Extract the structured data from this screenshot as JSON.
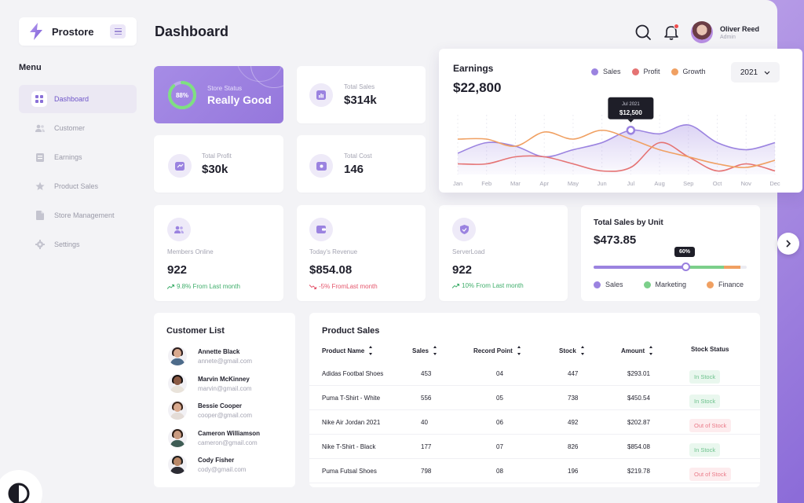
{
  "app": {
    "name": "Prostore"
  },
  "sidebar": {
    "heading": "Menu",
    "items": [
      {
        "label": "Dashboard",
        "icon": "grid-icon",
        "active": true
      },
      {
        "label": "Customer",
        "icon": "users-icon",
        "active": false
      },
      {
        "label": "Earnings",
        "icon": "ledger-icon",
        "active": false
      },
      {
        "label": "Product Sales",
        "icon": "star-icon",
        "active": false
      },
      {
        "label": "Store Management",
        "icon": "document-icon",
        "active": false
      },
      {
        "label": "Settings",
        "icon": "gear-icon",
        "active": false
      }
    ]
  },
  "header": {
    "title": "Dashboard",
    "user": {
      "name": "Oliver Reed",
      "role": "Admin"
    }
  },
  "store_status": {
    "label": "Store Status",
    "value": "Really Good",
    "percent_text": "88%",
    "percent": 0.88
  },
  "stats": {
    "total_sales": {
      "label": "Total Sales",
      "value": "$314k"
    },
    "total_profit": {
      "label": "Total Profit",
      "value": "$30k"
    },
    "total_cost": {
      "label": "Total Cost",
      "value": "146"
    }
  },
  "metrics": {
    "members_online": {
      "label": "Members Online",
      "value": "922",
      "trend": "9.8% From Last month",
      "direction": "up"
    },
    "todays_revenue": {
      "label": "Today's Revenue",
      "value": "$854.08",
      "trend": "-5% FromLast month",
      "direction": "down"
    },
    "server_load": {
      "label": "ServerLoad",
      "value": "922",
      "trend": "10% From Last month",
      "direction": "up"
    }
  },
  "earnings": {
    "title": "Earnings",
    "total": "$22,800",
    "year": "2021",
    "tooltip": {
      "date": "Jul 2021",
      "value": "$12,500"
    }
  },
  "chart_data": {
    "type": "line",
    "title": "Earnings",
    "x": [
      "Jan",
      "Feb",
      "Mar",
      "Apr",
      "May",
      "Jun",
      "Jul",
      "Aug",
      "Sep",
      "Oct",
      "Nov",
      "Dec"
    ],
    "series": [
      {
        "name": "Sales",
        "color": "#9b83e0",
        "fill": true,
        "values": [
          6,
          9,
          8,
          5,
          7,
          9,
          12.5,
          11.5,
          14,
          9,
          7,
          9
        ]
      },
      {
        "name": "Profit",
        "color": "#e57373",
        "values": [
          3,
          3,
          5,
          5,
          3,
          1,
          2,
          9,
          5,
          1,
          3,
          1
        ]
      },
      {
        "name": "Growth",
        "color": "#f0a062",
        "values": [
          10,
          10,
          8,
          12,
          10,
          12.5,
          10,
          7,
          5,
          3,
          2,
          4
        ]
      }
    ],
    "ylim": [
      0,
      16
    ],
    "grid": true,
    "legend": "top-right"
  },
  "unit_sales": {
    "title": "Total Sales by Unit",
    "value": "$473.85",
    "tooltip": "60%",
    "segments": [
      {
        "name": "Sales",
        "share": 0.6,
        "color": "#9b83e0"
      },
      {
        "name": "Marketing",
        "share": 0.25,
        "color": "#7ccf8a"
      },
      {
        "name": "Finance",
        "share": 0.11,
        "color": "#f0a062"
      }
    ]
  },
  "customers": {
    "title": "Customer List",
    "items": [
      {
        "name": "Annette Black",
        "email": "annete@gmail.com"
      },
      {
        "name": "Marvin McKinney",
        "email": "marvin@gmail.com"
      },
      {
        "name": "Bessie Cooper",
        "email": "cooper@gmail.com"
      },
      {
        "name": "Cameron Williamson",
        "email": "cameron@gmail.com"
      },
      {
        "name": "Cody Fisher",
        "email": "cody@gmail.com"
      }
    ]
  },
  "products": {
    "title": "Product Sales",
    "columns": [
      "Product Name",
      "Sales",
      "Record Point",
      "Stock",
      "Amount",
      "Stock Status"
    ],
    "rows": [
      {
        "name": "Adidas Footbal Shoes",
        "sales": "453",
        "record": "04",
        "stock": "447",
        "amount": "$293.01",
        "status": "In Stock",
        "in": true
      },
      {
        "name": "Puma T-Shirt - White",
        "sales": "556",
        "record": "05",
        "stock": "738",
        "amount": "$450.54",
        "status": "In Stock",
        "in": true
      },
      {
        "name": "Nike Air Jordan 2021",
        "sales": "40",
        "record": "06",
        "stock": "492",
        "amount": "$202.87",
        "status": "Out of Stock",
        "in": false
      },
      {
        "name": "Nike T-Shirt - Black",
        "sales": "177",
        "record": "07",
        "stock": "826",
        "amount": "$854.08",
        "status": "In Stock",
        "in": true
      },
      {
        "name": "Puma Futsal Shoes",
        "sales": "798",
        "record": "08",
        "stock": "196",
        "amount": "$219.78",
        "status": "Out of Stock",
        "in": false
      }
    ]
  },
  "colors": {
    "accent": "#9b83e0",
    "up": "#3fae6b",
    "down": "#e4556b"
  }
}
